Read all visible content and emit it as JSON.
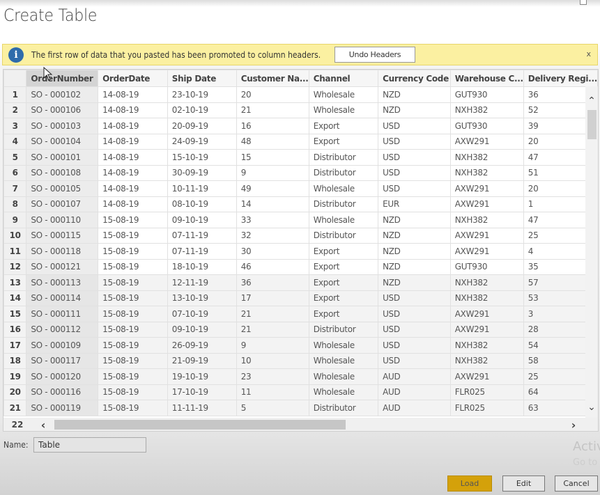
{
  "window": {
    "title": "Create Table"
  },
  "banner": {
    "icon": "info-icon",
    "icon_glyph": "i",
    "message": "The first row of data that you pasted has been promoted to column headers.",
    "undo_label": "Undo Headers",
    "close_glyph": "x"
  },
  "grid": {
    "columns": [
      "OrderNumber",
      "OrderDate",
      "Ship Date",
      "Customer Na...",
      "Channel",
      "Currency Code",
      "Warehouse C...",
      "Delivery Regi..."
    ],
    "rows": [
      [
        "1",
        "SO - 000102",
        "14-08-19",
        "23-10-19",
        "20",
        "Wholesale",
        "NZD",
        "GUT930",
        "36"
      ],
      [
        "2",
        "SO - 000106",
        "14-08-19",
        "02-10-19",
        "21",
        "Wholesale",
        "NZD",
        "NXH382",
        "52"
      ],
      [
        "3",
        "SO - 000103",
        "14-08-19",
        "20-09-19",
        "16",
        "Export",
        "USD",
        "GUT930",
        "39"
      ],
      [
        "4",
        "SO - 000104",
        "14-08-19",
        "24-09-19",
        "48",
        "Export",
        "USD",
        "AXW291",
        "20"
      ],
      [
        "5",
        "SO - 000101",
        "14-08-19",
        "15-10-19",
        "15",
        "Distributor",
        "USD",
        "NXH382",
        "47"
      ],
      [
        "6",
        "SO - 000108",
        "14-08-19",
        "30-09-19",
        "9",
        "Distributor",
        "USD",
        "NXH382",
        "51"
      ],
      [
        "7",
        "SO - 000105",
        "14-08-19",
        "10-11-19",
        "49",
        "Wholesale",
        "USD",
        "AXW291",
        "20"
      ],
      [
        "8",
        "SO - 000107",
        "14-08-19",
        "08-10-19",
        "14",
        "Distributor",
        "EUR",
        "AXW291",
        "1"
      ],
      [
        "9",
        "SO - 000110",
        "15-08-19",
        "09-10-19",
        "33",
        "Wholesale",
        "NZD",
        "NXH382",
        "47"
      ],
      [
        "10",
        "SO - 000115",
        "15-08-19",
        "07-11-19",
        "32",
        "Distributor",
        "NZD",
        "AXW291",
        "25"
      ],
      [
        "11",
        "SO - 000118",
        "15-08-19",
        "07-11-19",
        "30",
        "Export",
        "NZD",
        "AXW291",
        "4"
      ],
      [
        "12",
        "SO - 000121",
        "15-08-19",
        "18-10-19",
        "46",
        "Export",
        "NZD",
        "GUT930",
        "35"
      ],
      [
        "13",
        "SO - 000113",
        "15-08-19",
        "12-11-19",
        "36",
        "Export",
        "NZD",
        "NXH382",
        "57"
      ],
      [
        "14",
        "SO - 000114",
        "15-08-19",
        "13-10-19",
        "17",
        "Export",
        "USD",
        "NXH382",
        "53"
      ],
      [
        "15",
        "SO - 000111",
        "15-08-19",
        "07-10-19",
        "21",
        "Export",
        "USD",
        "AXW291",
        "3"
      ],
      [
        "16",
        "SO - 000112",
        "15-08-19",
        "09-10-19",
        "21",
        "Distributor",
        "USD",
        "AXW291",
        "28"
      ],
      [
        "17",
        "SO - 000109",
        "15-08-19",
        "26-09-19",
        "9",
        "Wholesale",
        "USD",
        "NXH382",
        "54"
      ],
      [
        "18",
        "SO - 000117",
        "15-08-19",
        "21-09-19",
        "10",
        "Wholesale",
        "USD",
        "NXH382",
        "58"
      ],
      [
        "19",
        "SO - 000120",
        "15-08-19",
        "19-10-19",
        "23",
        "Wholesale",
        "AUD",
        "AXW291",
        "25"
      ],
      [
        "20",
        "SO - 000116",
        "15-08-19",
        "17-10-19",
        "11",
        "Wholesale",
        "AUD",
        "FLR025",
        "64"
      ],
      [
        "21",
        "SO - 000119",
        "15-08-19",
        "11-11-19",
        "5",
        "Distributor",
        "AUD",
        "FLR025",
        "63"
      ]
    ],
    "partial_row_number": "22",
    "scroll": {
      "up_glyph": "^",
      "down_glyph": "v",
      "left_glyph": "<",
      "right_glyph": ">"
    }
  },
  "footer": {
    "name_label": "Name:",
    "name_value": "Table",
    "watermark_line1": "Activ",
    "watermark_line2": "Go to",
    "buttons": {
      "load": "Load",
      "edit": "Edit",
      "cancel": "Cancel"
    }
  },
  "colors": {
    "banner_bg": "#fbf0a1",
    "info_icon": "#2e6bab",
    "load_button": "#d4a10a"
  }
}
